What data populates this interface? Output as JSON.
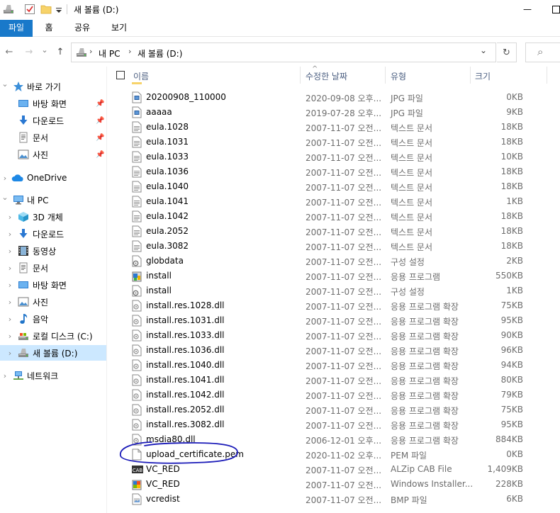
{
  "window": {
    "title": "새 볼륨 (D:)",
    "minimize_glyph": "—",
    "close_glyph": "✕"
  },
  "ribbon": {
    "tabs": [
      {
        "label": "파일"
      },
      {
        "label": "홈"
      },
      {
        "label": "공유"
      },
      {
        "label": "보기"
      }
    ]
  },
  "address": {
    "segments": [
      "내 PC",
      "새 볼륨 (D:)"
    ],
    "back_glyph": "←",
    "forward_glyph": "→",
    "recent_glyph": "⌄",
    "up_glyph": "↑",
    "dropdown_glyph": "⌄",
    "refresh_glyph": "↻",
    "search_placeholder": "",
    "search_glyph": "⌕"
  },
  "nav": {
    "quick_access": {
      "label": "바로 가기",
      "icon": "star-icon"
    },
    "quick_items": [
      {
        "label": "바탕 화면",
        "icon": "desktop-icon",
        "pinned": true
      },
      {
        "label": "다운로드",
        "icon": "download-icon",
        "pinned": true
      },
      {
        "label": "문서",
        "icon": "document-icon",
        "pinned": true
      },
      {
        "label": "사진",
        "icon": "picture-icon",
        "pinned": true
      }
    ],
    "onedrive": {
      "label": "OneDrive",
      "icon": "cloud-icon"
    },
    "this_pc": {
      "label": "내 PC",
      "icon": "computer-icon"
    },
    "pc_items": [
      {
        "label": "3D 개체",
        "icon": "cube-icon"
      },
      {
        "label": "다운로드",
        "icon": "download-icon"
      },
      {
        "label": "동영상",
        "icon": "video-icon"
      },
      {
        "label": "문서",
        "icon": "document-icon"
      },
      {
        "label": "바탕 화면",
        "icon": "desktop-icon"
      },
      {
        "label": "사진",
        "icon": "picture-icon"
      },
      {
        "label": "음악",
        "icon": "music-icon"
      },
      {
        "label": "로컬 디스크 (C:)",
        "icon": "drive-icon"
      },
      {
        "label": "새 볼륨 (D:)",
        "icon": "drive-icon",
        "selected": true
      }
    ],
    "network": {
      "label": "네트워크",
      "icon": "network-icon"
    },
    "pin_glyph": "📌",
    "expand_glyph": "›",
    "expanded_glyph": "⌄"
  },
  "columns": {
    "name": "이름",
    "date": "수정한 날짜",
    "type": "유형",
    "size": "크기",
    "sort_glyph": "^"
  },
  "files": [
    {
      "name": "20200908_110000",
      "date": "2020-09-08 오후...",
      "type": "JPG 파일",
      "size": "0KB",
      "icon": "image-file-icon"
    },
    {
      "name": "aaaaa",
      "date": "2019-07-28 오후...",
      "type": "JPG 파일",
      "size": "9KB",
      "icon": "image-file-icon"
    },
    {
      "name": "eula.1028",
      "date": "2007-11-07 오전...",
      "type": "텍스트 문서",
      "size": "18KB",
      "icon": "text-file-icon"
    },
    {
      "name": "eula.1031",
      "date": "2007-11-07 오전...",
      "type": "텍스트 문서",
      "size": "18KB",
      "icon": "text-file-icon"
    },
    {
      "name": "eula.1033",
      "date": "2007-11-07 오전...",
      "type": "텍스트 문서",
      "size": "10KB",
      "icon": "text-file-icon"
    },
    {
      "name": "eula.1036",
      "date": "2007-11-07 오전...",
      "type": "텍스트 문서",
      "size": "18KB",
      "icon": "text-file-icon"
    },
    {
      "name": "eula.1040",
      "date": "2007-11-07 오전...",
      "type": "텍스트 문서",
      "size": "18KB",
      "icon": "text-file-icon"
    },
    {
      "name": "eula.1041",
      "date": "2007-11-07 오전...",
      "type": "텍스트 문서",
      "size": "1KB",
      "icon": "text-file-icon"
    },
    {
      "name": "eula.1042",
      "date": "2007-11-07 오전...",
      "type": "텍스트 문서",
      "size": "18KB",
      "icon": "text-file-icon"
    },
    {
      "name": "eula.2052",
      "date": "2007-11-07 오전...",
      "type": "텍스트 문서",
      "size": "18KB",
      "icon": "text-file-icon"
    },
    {
      "name": "eula.3082",
      "date": "2007-11-07 오전...",
      "type": "텍스트 문서",
      "size": "18KB",
      "icon": "text-file-icon"
    },
    {
      "name": "globdata",
      "date": "2007-11-07 오전...",
      "type": "구성 설정",
      "size": "2KB",
      "icon": "settings-file-icon"
    },
    {
      "name": "install",
      "date": "2007-11-07 오전...",
      "type": "응용 프로그램",
      "size": "550KB",
      "icon": "installer-icon"
    },
    {
      "name": "install",
      "date": "2007-11-07 오전...",
      "type": "구성 설정",
      "size": "1KB",
      "icon": "settings-file-icon"
    },
    {
      "name": "install.res.1028.dll",
      "date": "2007-11-07 오전...",
      "type": "응용 프로그램 확장",
      "size": "75KB",
      "icon": "dll-file-icon"
    },
    {
      "name": "install.res.1031.dll",
      "date": "2007-11-07 오전...",
      "type": "응용 프로그램 확장",
      "size": "95KB",
      "icon": "dll-file-icon"
    },
    {
      "name": "install.res.1033.dll",
      "date": "2007-11-07 오전...",
      "type": "응용 프로그램 확장",
      "size": "90KB",
      "icon": "dll-file-icon"
    },
    {
      "name": "install.res.1036.dll",
      "date": "2007-11-07 오전...",
      "type": "응용 프로그램 확장",
      "size": "96KB",
      "icon": "dll-file-icon"
    },
    {
      "name": "install.res.1040.dll",
      "date": "2007-11-07 오전...",
      "type": "응용 프로그램 확장",
      "size": "94KB",
      "icon": "dll-file-icon"
    },
    {
      "name": "install.res.1041.dll",
      "date": "2007-11-07 오전...",
      "type": "응용 프로그램 확장",
      "size": "80KB",
      "icon": "dll-file-icon"
    },
    {
      "name": "install.res.1042.dll",
      "date": "2007-11-07 오전...",
      "type": "응용 프로그램 확장",
      "size": "79KB",
      "icon": "dll-file-icon"
    },
    {
      "name": "install.res.2052.dll",
      "date": "2007-11-07 오전...",
      "type": "응용 프로그램 확장",
      "size": "75KB",
      "icon": "dll-file-icon"
    },
    {
      "name": "install.res.3082.dll",
      "date": "2007-11-07 오전...",
      "type": "응용 프로그램 확장",
      "size": "95KB",
      "icon": "dll-file-icon"
    },
    {
      "name": "msdia80.dll",
      "date": "2006-12-01 오후...",
      "type": "응용 프로그램 확장",
      "size": "884KB",
      "icon": "dll-file-icon"
    },
    {
      "name": "upload_certificate.pem",
      "date": "2020-11-02 오후...",
      "type": "PEM 파일",
      "size": "0KB",
      "icon": "blank-file-icon"
    },
    {
      "name": "VC_RED",
      "date": "2007-11-07 오전...",
      "type": "ALZip CAB File",
      "size": "1,409KB",
      "icon": "cab-file-icon"
    },
    {
      "name": "VC_RED",
      "date": "2007-11-07 오전...",
      "type": "Windows Installer...",
      "size": "228KB",
      "icon": "msi-file-icon"
    },
    {
      "name": "vcredist",
      "date": "2007-11-07 오전...",
      "type": "BMP 파일",
      "size": "6KB",
      "icon": "bitmap-file-icon"
    }
  ],
  "colors": {
    "accent": "#1979ca",
    "selection": "#cce8ff",
    "annotation": "#1a1ab8",
    "header_text": "#4d6082",
    "secondary_text": "#6d6d6d"
  }
}
